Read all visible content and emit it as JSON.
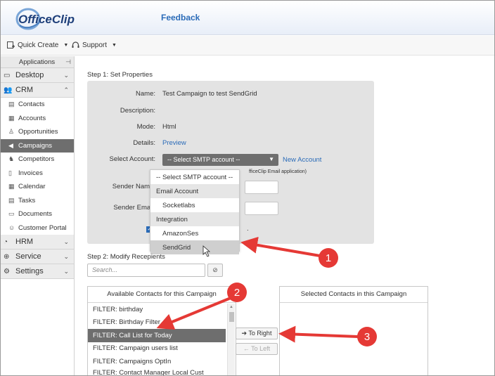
{
  "header": {
    "logo_text": "OfficeClip",
    "feedback_label": "Feedback"
  },
  "menubar": {
    "quick_create_label": "Quick Create",
    "support_label": "Support"
  },
  "sidebar": {
    "applications_label": "Applications",
    "sections": {
      "desktop": "Desktop",
      "crm": "CRM",
      "hrm": "HRM",
      "service": "Service",
      "settings": "Settings"
    },
    "crm_items": [
      "Contacts",
      "Accounts",
      "Opportunities",
      "Campaigns",
      "Competitors",
      "Invoices",
      "Calendar",
      "Tasks",
      "Documents",
      "Customer Portal"
    ],
    "active_item": "Campaigns"
  },
  "step1": {
    "title": "Step 1: Set Properties",
    "name_label": "Name:",
    "name_value": "Test Campaign to test SendGrid",
    "description_label": "Description:",
    "mode_label": "Mode:",
    "mode_value": "Html",
    "details_label": "Details:",
    "details_link": "Preview",
    "select_account_label": "Select Account:",
    "select_account_value": "-- Select SMTP account --",
    "new_account_link": "New Account",
    "note_tail": "fficeClip Email application)",
    "sender_name_label": "Sender Name:",
    "sender_email_label": "Sender Email:",
    "checkbox_tail": "."
  },
  "dropdown": {
    "options": [
      {
        "kind": "option",
        "label": "-- Select SMTP account --"
      },
      {
        "kind": "group",
        "label": "Email Account"
      },
      {
        "kind": "option",
        "label": "Socketlabs"
      },
      {
        "kind": "group",
        "label": "Integration"
      },
      {
        "kind": "option",
        "label": "AmazonSes"
      },
      {
        "kind": "option",
        "label": "SendGrid"
      }
    ],
    "highlighted": "SendGrid"
  },
  "step2": {
    "title": "Step 2: Modify Recepients",
    "search_placeholder": "Search...",
    "available_header": "Available Contacts for this Campaign",
    "selected_header": "Selected Contacts in this Campaign",
    "available_items": [
      "FILTER: birthday",
      "FILTER: Birthday Filter",
      "FILTER: Call List for Today",
      "FILTER: Campaign users list",
      "FILTER: Campaigns OptIn",
      "FILTER: Contact Manager Local Cust"
    ],
    "selected_available": "FILTER: Call List for Today",
    "to_right_label": "To Right",
    "to_left_label": "To Left"
  },
  "annotations": {
    "callouts": [
      "1",
      "2",
      "3"
    ],
    "arrow_color": "#e53935"
  }
}
